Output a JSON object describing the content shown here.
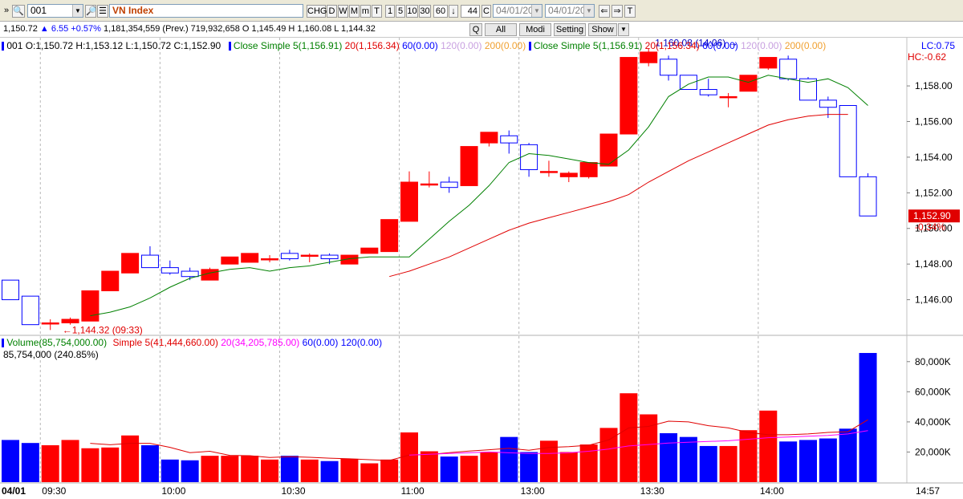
{
  "toolbar": {
    "symbol_value": "001",
    "index_name": "VN Index",
    "chg_label": "CHG",
    "periods": [
      "D",
      "W",
      "M",
      "m",
      "T",
      "1",
      "5",
      "10",
      "30"
    ],
    "interval_value": "60",
    "count_value": "44",
    "c_label": "C",
    "date_from": "04/01/20",
    "date_to": "04/01/20"
  },
  "quote_bar": {
    "last": "1,150.72",
    "change": "6.55",
    "change_pct": "+0.57%",
    "volume_text": "1,181,354,559 (Prev.) 719,932,658 O 1,145.49 H 1,160.08 L 1,144.32"
  },
  "tabs": [
    "Q",
    "All",
    "Modi",
    "Setting",
    "Show"
  ],
  "price_legend": {
    "ohlc": "001 O:1,150.72 H:1,153.12 L:1,150.72 C:1,152.90",
    "ma_a": {
      "name": "Close Simple 5",
      "value": "(1,156.91)"
    },
    "ma_b": "20(1,156.34)",
    "ma_c": "60(0.00)",
    "ma_d": "120(0.00)",
    "ma_e": "200(0.00)",
    "ma_f": {
      "name": "Close Simple 5",
      "value": "(1,156.91)"
    },
    "ma_g": "20(1,156.34)",
    "ma_h": "60(0.00)",
    "ma_i": "120(0.00)",
    "ma_j": "200(0.00)",
    "lc": "LC:0.75",
    "hc": "HC:-0.62"
  },
  "volume_legend": {
    "title": "Volume(85,754,000.00)",
    "ma_a": "Simple 5(41,444,660.00)",
    "ma_b": "20(34,205,785.00)",
    "ma_c": "60(0.00)",
    "ma_d": "120(0.00)",
    "current": "85,754,000 (240.85%)"
  },
  "colors": {
    "up": "#ff0000",
    "down": "#0000ff",
    "ma5": "#008000",
    "ma20": "#e00000",
    "vol_ma20": "#ff00ff"
  },
  "chart_data": [
    {
      "type": "candlestick",
      "title": "VN Index",
      "y_ticks": [
        "1,146.00",
        "1,148.00",
        "1,150.00",
        "1,152.00",
        "1,154.00",
        "1,156.00",
        "1,158.00"
      ],
      "ylim": [
        1144.0,
        1160.3
      ],
      "x_labels": [
        {
          "index": 0,
          "text": "04/01"
        },
        {
          "index": 2,
          "text": "09:30"
        },
        {
          "index": 8,
          "text": "10:00"
        },
        {
          "index": 14,
          "text": "10:30"
        },
        {
          "index": 20,
          "text": "11:00"
        },
        {
          "index": 26,
          "text": "13:00"
        },
        {
          "index": 32,
          "text": "13:30"
        },
        {
          "index": 38,
          "text": "14:00"
        },
        {
          "index": 44,
          "text": "14:57"
        }
      ],
      "candles": [
        {
          "o": 1147.1,
          "h": 1147.1,
          "l": 1146.0,
          "c": 1146.0
        },
        {
          "o": 1146.2,
          "h": 1146.2,
          "l": 1144.6,
          "c": 1144.6
        },
        {
          "o": 1144.7,
          "h": 1144.9,
          "l": 1144.3,
          "c": 1144.7
        },
        {
          "o": 1144.7,
          "h": 1145.0,
          "l": 1144.6,
          "c": 1144.9
        },
        {
          "o": 1144.8,
          "h": 1146.5,
          "l": 1144.8,
          "c": 1146.5
        },
        {
          "o": 1146.5,
          "h": 1147.6,
          "l": 1146.5,
          "c": 1147.6
        },
        {
          "o": 1147.5,
          "h": 1148.6,
          "l": 1147.5,
          "c": 1148.6
        },
        {
          "o": 1148.5,
          "h": 1149.0,
          "l": 1147.8,
          "c": 1147.8
        },
        {
          "o": 1147.8,
          "h": 1148.2,
          "l": 1147.4,
          "c": 1147.5
        },
        {
          "o": 1147.6,
          "h": 1147.8,
          "l": 1147.1,
          "c": 1147.3
        },
        {
          "o": 1147.1,
          "h": 1147.8,
          "l": 1147.1,
          "c": 1147.7
        },
        {
          "o": 1148.0,
          "h": 1148.4,
          "l": 1148.0,
          "c": 1148.4
        },
        {
          "o": 1148.1,
          "h": 1148.6,
          "l": 1148.1,
          "c": 1148.6
        },
        {
          "o": 1148.3,
          "h": 1148.5,
          "l": 1148.1,
          "c": 1148.3
        },
        {
          "o": 1148.6,
          "h": 1148.8,
          "l": 1148.2,
          "c": 1148.3
        },
        {
          "o": 1148.5,
          "h": 1148.6,
          "l": 1148.1,
          "c": 1148.5
        },
        {
          "o": 1148.5,
          "h": 1148.6,
          "l": 1148.0,
          "c": 1148.3
        },
        {
          "o": 1148.0,
          "h": 1148.5,
          "l": 1148.0,
          "c": 1148.5
        },
        {
          "o": 1148.6,
          "h": 1148.9,
          "l": 1148.6,
          "c": 1148.9
        },
        {
          "o": 1148.7,
          "h": 1150.5,
          "l": 1148.7,
          "c": 1150.5
        },
        {
          "o": 1150.4,
          "h": 1153.2,
          "l": 1150.4,
          "c": 1152.6
        },
        {
          "o": 1152.5,
          "h": 1153.2,
          "l": 1152.3,
          "c": 1152.5
        },
        {
          "o": 1152.6,
          "h": 1152.9,
          "l": 1152.0,
          "c": 1152.3
        },
        {
          "o": 1152.4,
          "h": 1154.6,
          "l": 1152.4,
          "c": 1154.6
        },
        {
          "o": 1154.8,
          "h": 1155.4,
          "l": 1154.6,
          "c": 1155.4
        },
        {
          "o": 1155.2,
          "h": 1155.5,
          "l": 1154.2,
          "c": 1154.8
        },
        {
          "o": 1154.7,
          "h": 1154.8,
          "l": 1152.9,
          "c": 1153.3
        },
        {
          "o": 1153.2,
          "h": 1153.8,
          "l": 1152.9,
          "c": 1153.2
        },
        {
          "o": 1152.9,
          "h": 1153.2,
          "l": 1152.6,
          "c": 1153.1
        },
        {
          "o": 1152.9,
          "h": 1153.7,
          "l": 1152.8,
          "c": 1153.7
        },
        {
          "o": 1153.5,
          "h": 1155.3,
          "l": 1153.5,
          "c": 1155.3
        },
        {
          "o": 1155.3,
          "h": 1159.6,
          "l": 1155.3,
          "c": 1159.6
        },
        {
          "o": 1159.3,
          "h": 1160.1,
          "l": 1159.1,
          "c": 1159.9
        },
        {
          "o": 1159.5,
          "h": 1159.7,
          "l": 1158.3,
          "c": 1158.6
        },
        {
          "o": 1158.6,
          "h": 1158.6,
          "l": 1157.8,
          "c": 1157.8
        },
        {
          "o": 1157.8,
          "h": 1158.4,
          "l": 1157.4,
          "c": 1157.5
        },
        {
          "o": 1157.4,
          "h": 1157.6,
          "l": 1156.8,
          "c": 1157.4
        },
        {
          "o": 1157.7,
          "h": 1158.6,
          "l": 1157.7,
          "c": 1158.6
        },
        {
          "o": 1159.0,
          "h": 1159.5,
          "l": 1158.9,
          "c": 1159.6
        },
        {
          "o": 1159.5,
          "h": 1159.7,
          "l": 1158.3,
          "c": 1158.4
        },
        {
          "o": 1158.4,
          "h": 1158.5,
          "l": 1157.2,
          "c": 1157.2
        },
        {
          "o": 1157.2,
          "h": 1157.4,
          "l": 1156.2,
          "c": 1156.8
        },
        {
          "o": 1156.9,
          "h": 1156.9,
          "l": 1152.9,
          "c": 1152.9
        },
        {
          "o": 1152.9,
          "h": 1153.1,
          "l": 1150.7,
          "c": 1150.7
        }
      ],
      "ma5": [
        null,
        null,
        null,
        null,
        1145.1,
        1145.3,
        1145.6,
        1146.1,
        1146.7,
        1147.2,
        1147.5,
        1147.7,
        1147.8,
        1147.6,
        1147.8,
        1147.9,
        1148.1,
        1148.3,
        1148.4,
        1148.4,
        1148.4,
        1149.4,
        1150.4,
        1151.3,
        1152.4,
        1153.7,
        1154.2,
        1154.1,
        1153.9,
        1153.7,
        1153.6,
        1154.4,
        1155.7,
        1157.4,
        1158.1,
        1158.5,
        1158.5,
        1158.2,
        1158.6,
        1158.4,
        1158.2,
        1158.4,
        1157.9,
        1156.9
      ],
      "ma20": [
        null,
        null,
        null,
        null,
        null,
        null,
        null,
        null,
        null,
        null,
        null,
        null,
        null,
        null,
        null,
        null,
        null,
        null,
        null,
        1147.3,
        1147.6,
        1148.0,
        1148.4,
        1148.9,
        1149.4,
        1149.9,
        1150.3,
        1150.6,
        1150.9,
        1151.2,
        1151.5,
        1151.9,
        1152.6,
        1153.2,
        1153.8,
        1154.3,
        1154.8,
        1155.3,
        1155.8,
        1156.1,
        1156.3,
        1156.4,
        1156.4
      ],
      "price_low_label": "1,144.32 (09:33)",
      "price_high_label": "1,160.08 (14:06)",
      "last_price_label": "1,152.90",
      "last_change_label": "-0.34%"
    },
    {
      "type": "bar",
      "title": "Volume",
      "y_ticks": [
        "20,000K",
        "40,000K",
        "60,000K",
        "80,000K"
      ],
      "ylim": [
        0,
        90000000
      ],
      "values": [
        28000000,
        26000000,
        24500000,
        28000000,
        22500000,
        23000000,
        31000000,
        24500000,
        15000000,
        14500000,
        17500000,
        17500000,
        17500000,
        15000000,
        17500000,
        15000000,
        14000000,
        15500000,
        12500000,
        15000000,
        33000000,
        20500000,
        17000000,
        17500000,
        20000000,
        30000000,
        20000000,
        27500000,
        20000000,
        25000000,
        36000000,
        59000000,
        45000000,
        32500000,
        30000000,
        24000000,
        24000000,
        34500000,
        47500000,
        27000000,
        28000000,
        29000000,
        35500000,
        85754000
      ],
      "ma5": [
        null,
        null,
        null,
        null,
        25800000,
        24800000,
        25800000,
        25800000,
        23100000,
        19600000,
        20500000,
        17800000,
        17600000,
        16400000,
        16900000,
        16500000,
        15900000,
        15500000,
        14900000,
        14400000,
        18000000,
        18300000,
        19600000,
        20600000,
        21500000,
        22500000,
        21200000,
        23000000,
        23600000,
        24500000,
        28000000,
        36000000,
        37000000,
        40500000,
        40000000,
        37500000,
        36000000,
        33000000,
        31500000,
        31500000,
        32000000,
        33000000,
        33500000,
        41444660
      ],
      "ma20": [
        null,
        null,
        null,
        null,
        null,
        null,
        null,
        null,
        null,
        null,
        null,
        null,
        null,
        null,
        null,
        null,
        null,
        null,
        null,
        null,
        18000000,
        18500000,
        19000000,
        19500000,
        20000000,
        19500000,
        19000000,
        19000000,
        19500000,
        20500000,
        22000000,
        24000000,
        25000000,
        26000000,
        26500000,
        27000000,
        27500000,
        28500000,
        29500000,
        30000000,
        30500000,
        31000000,
        32000000,
        34205785
      ]
    }
  ]
}
